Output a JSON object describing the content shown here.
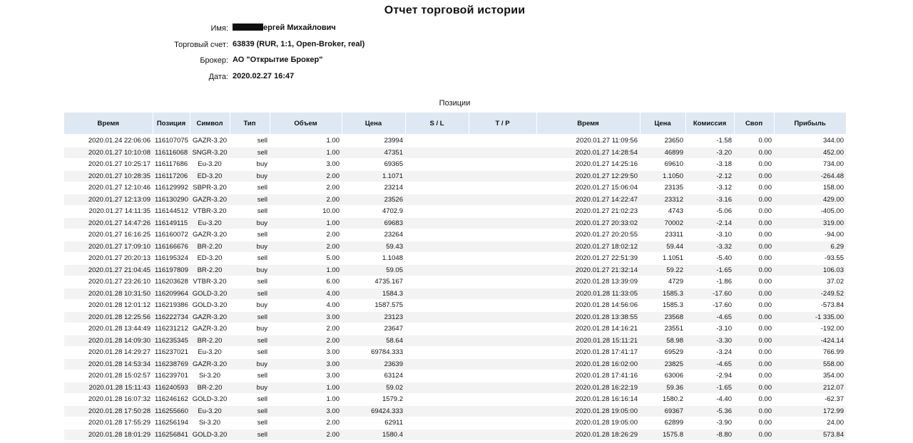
{
  "report": {
    "title": "Отчет торговой истории",
    "info": [
      {
        "label": "Имя:",
        "value": "ергей Михайлович",
        "redacted_prefix": true
      },
      {
        "label": "Торговый счет:",
        "value": "63839 (RUR, 1:1, Open-Broker, real)",
        "redacted_prefix": false
      },
      {
        "label": "Брокер:",
        "value": "АО \"Открытие Брокер\"",
        "redacted_prefix": false
      },
      {
        "label": "Дата:",
        "value": "2020.02.27 16:47",
        "redacted_prefix": false
      }
    ],
    "section_title": "Позиции"
  },
  "table": {
    "columns": [
      "Время",
      "Позиция",
      "Символ",
      "Тип",
      "Объем",
      "Цена",
      "S / L",
      "T / P",
      "Время",
      "Цена",
      "Комиссия",
      "Своп",
      "Прибыль"
    ],
    "rows": [
      [
        "2020.01.24 22:06:06",
        "116107075",
        "GAZR-3.20",
        "sell",
        "1.00",
        "23994",
        "",
        "",
        "2020.01.27 11:09:56",
        "23650",
        "-1.58",
        "0.00",
        "344.00"
      ],
      [
        "2020.01.27 10:10:08",
        "116116068",
        "SNGR-3.20",
        "sell",
        "1.00",
        "47351",
        "",
        "",
        "2020.01.27 14:28:54",
        "46899",
        "-3.20",
        "0.00",
        "452.00"
      ],
      [
        "2020.01.27 10:25:17",
        "116117686",
        "Eu-3.20",
        "buy",
        "3.00",
        "69365",
        "",
        "",
        "2020.01.27 14:25:16",
        "69610",
        "-3.18",
        "0.00",
        "734.00"
      ],
      [
        "2020.01.27 10:28:35",
        "116117206",
        "ED-3.20",
        "buy",
        "2.00",
        "1.1071",
        "",
        "",
        "2020.01.27 12:29:50",
        "1.1050",
        "-2.12",
        "0.00",
        "-264.48"
      ],
      [
        "2020.01.27 12:10:46",
        "116129992",
        "SBPR-3.20",
        "sell",
        "2.00",
        "23214",
        "",
        "",
        "2020.01.27 15:06:04",
        "23135",
        "-3.12",
        "0.00",
        "158.00"
      ],
      [
        "2020.01.27 12:13:09",
        "116130290",
        "GAZR-3.20",
        "sell",
        "2.00",
        "23526",
        "",
        "",
        "2020.01.27 14:22:47",
        "23312",
        "-3.16",
        "0.00",
        "429.00"
      ],
      [
        "2020.01.27 14:11:35",
        "116144512",
        "VTBR-3.20",
        "sell",
        "10.00",
        "4702.9",
        "",
        "",
        "2020.01.27 21:02:23",
        "4743",
        "-5.06",
        "0.00",
        "-405.00"
      ],
      [
        "2020.01.27 14:47:26",
        "116149115",
        "Eu-3.20",
        "buy",
        "1.00",
        "69683",
        "",
        "",
        "2020.01.27 20:33:02",
        "70002",
        "-2.14",
        "0.00",
        "319.00"
      ],
      [
        "2020.01.27 16:16:25",
        "116160072",
        "GAZR-3.20",
        "sell",
        "2.00",
        "23264",
        "",
        "",
        "2020.01.27 20:20:55",
        "23311",
        "-3.10",
        "0.00",
        "-94.00"
      ],
      [
        "2020.01.27 17:09:10",
        "116166676",
        "BR-2.20",
        "buy",
        "2.00",
        "59.43",
        "",
        "",
        "2020.01.27 18:02:12",
        "59.44",
        "-3.32",
        "0.00",
        "6.29"
      ],
      [
        "2020.01.27 20:20:13",
        "116195324",
        "ED-3.20",
        "sell",
        "5.00",
        "1.1048",
        "",
        "",
        "2020.01.27 22:51:39",
        "1.1051",
        "-5.40",
        "0.00",
        "-93.55"
      ],
      [
        "2020.01.27 21:04:45",
        "116197809",
        "BR-2.20",
        "buy",
        "1.00",
        "59.05",
        "",
        "",
        "2020.01.27 21:32:14",
        "59.22",
        "-1.65",
        "0.00",
        "106.03"
      ],
      [
        "2020.01.27 23:26:10",
        "116203628",
        "VTBR-3.20",
        "sell",
        "6.00",
        "4735.167",
        "",
        "",
        "2020.01.28 13:39:09",
        "4729",
        "-1.86",
        "0.00",
        "37.02"
      ],
      [
        "2020.01.28 10:31:50",
        "116209964",
        "GOLD-3.20",
        "sell",
        "4.00",
        "1584.3",
        "",
        "",
        "2020.01.28 11:33:05",
        "1585.3",
        "-17.60",
        "0.00",
        "-249.52"
      ],
      [
        "2020.01.28 12:01:12",
        "116219386",
        "GOLD-3.20",
        "buy",
        "4.00",
        "1587.575",
        "",
        "",
        "2020.01.28 14:56:06",
        "1585.3",
        "-17.60",
        "0.00",
        "-573.84"
      ],
      [
        "2020.01.28 12:25:56",
        "116222734",
        "GAZR-3.20",
        "sell",
        "3.00",
        "23123",
        "",
        "",
        "2020.01.28 13:38:55",
        "23568",
        "-4.65",
        "0.00",
        "-1 335.00"
      ],
      [
        "2020.01.28 13:44:49",
        "116231212",
        "GAZR-3.20",
        "buy",
        "2.00",
        "23647",
        "",
        "",
        "2020.01.28 14:16:21",
        "23551",
        "-3.10",
        "0.00",
        "-192.00"
      ],
      [
        "2020.01.28 14:09:30",
        "116235345",
        "BR-2.20",
        "sell",
        "2.00",
        "58.64",
        "",
        "",
        "2020.01.28 15:11:21",
        "58.98",
        "-3.30",
        "0.00",
        "-424.14"
      ],
      [
        "2020.01.28 14:29:27",
        "116237021",
        "Eu-3.20",
        "sell",
        "3.00",
        "69784.333",
        "",
        "",
        "2020.01.28 17:41:17",
        "69529",
        "-3.24",
        "0.00",
        "766.99"
      ],
      [
        "2020.01.28 14:53:34",
        "116238769",
        "GAZR-3.20",
        "buy",
        "3.00",
        "23639",
        "",
        "",
        "2020.01.28 16:02:00",
        "23825",
        "-4.65",
        "0.00",
        "558.00"
      ],
      [
        "2020.01.28 15:02:57",
        "116239701",
        "Si-3.20",
        "sell",
        "3.00",
        "63124",
        "",
        "",
        "2020.01.28 17:41:16",
        "63006",
        "-2.94",
        "0.00",
        "354.00"
      ],
      [
        "2020.01.28 15:11:43",
        "116240593",
        "BR-2.20",
        "buy",
        "1.00",
        "59.02",
        "",
        "",
        "2020.01.28 16:22:19",
        "59.36",
        "-1.65",
        "0.00",
        "212.07"
      ],
      [
        "2020.01.28 16:07:32",
        "116246162",
        "GOLD-3.20",
        "sell",
        "1.00",
        "1579.2",
        "",
        "",
        "2020.01.28 16:16:14",
        "1580.2",
        "-4.40",
        "0.00",
        "-62.37"
      ],
      [
        "2020.01.28 17:50:28",
        "116255660",
        "Eu-3.20",
        "sell",
        "3.00",
        "69424.333",
        "",
        "",
        "2020.01.28 19:05:00",
        "69367",
        "-5.36",
        "0.00",
        "172.99"
      ],
      [
        "2020.01.28 17:55:29",
        "116256194",
        "Si-3.20",
        "sell",
        "2.00",
        "62911",
        "",
        "",
        "2020.01.28 19:05:00",
        "62899",
        "-3.90",
        "0.00",
        "24.00"
      ],
      [
        "2020.01.28 18:01:29",
        "116256841",
        "GOLD-3.20",
        "sell",
        "2.00",
        "1580.4",
        "",
        "",
        "2020.01.28 18:26:29",
        "1575.8",
        "-8.80",
        "0.00",
        "573.84"
      ]
    ]
  },
  "colors": {
    "header_bg": "#dde8f3",
    "row_alt_bg": "#f3f3f3",
    "redaction": "#111111"
  }
}
